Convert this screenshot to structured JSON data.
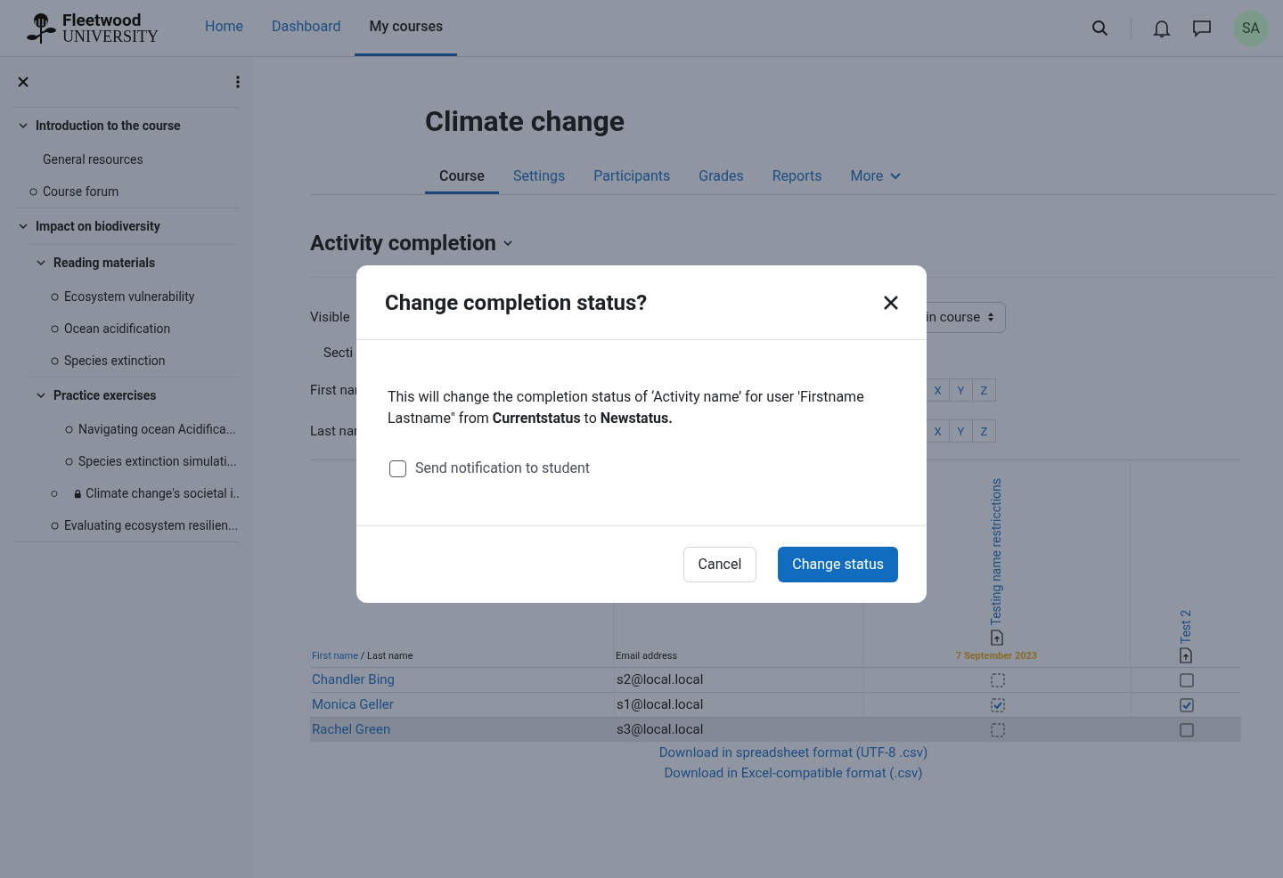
{
  "header": {
    "logo": {
      "name": "Fleetwood",
      "sub": "UNIVERSITY"
    },
    "nav": [
      {
        "label": "Home",
        "selected": false
      },
      {
        "label": "Dashboard",
        "selected": false
      },
      {
        "label": "My courses",
        "selected": true
      }
    ],
    "avatar": "SA"
  },
  "sidebar": {
    "items": [
      {
        "kind": "section",
        "label": "Introduction to the course",
        "expanded": true,
        "children": [
          {
            "kind": "page",
            "label": "General resources"
          },
          {
            "kind": "activity",
            "label": "Course forum"
          }
        ]
      },
      {
        "kind": "section",
        "label": "Impact on biodiversity",
        "expanded": true,
        "children": [
          {
            "kind": "section",
            "label": "Reading materials",
            "expanded": true,
            "children": [
              {
                "kind": "activity",
                "label": "Ecosystem vulnerability"
              },
              {
                "kind": "activity",
                "label": "Ocean acidification"
              },
              {
                "kind": "activity",
                "label": "Species extinction"
              }
            ]
          },
          {
            "kind": "section",
            "label": "Practice exercises",
            "expanded": true,
            "children": [
              {
                "kind": "activity",
                "label": "Navigating ocean Acidifica...",
                "indented": true
              },
              {
                "kind": "activity",
                "label": "Species extinction simulati...",
                "indented": true
              },
              {
                "kind": "activity",
                "label": "Climate change's societal i..",
                "locked": true
              },
              {
                "kind": "activity",
                "label": "Evaluating ecosystem resilien..."
              }
            ]
          }
        ]
      }
    ]
  },
  "course": {
    "title": "Climate change",
    "tabs": [
      {
        "label": "Course",
        "selected": true
      },
      {
        "label": "Settings",
        "selected": false
      },
      {
        "label": "Participants",
        "selected": false
      },
      {
        "label": "Grades",
        "selected": false
      },
      {
        "label": "Reports",
        "selected": false
      },
      {
        "label": "More",
        "selected": false
      }
    ],
    "heading": "Activity completion"
  },
  "filters": {
    "visible_label": "Visible",
    "select": "in course",
    "section_label": "Secti",
    "first_label": "First nar",
    "first_letters": [
      "X",
      "Y",
      "Z"
    ],
    "last_label": "Last nar",
    "last_letters": [
      "X",
      "Y",
      "Z"
    ]
  },
  "table": {
    "name_sort": "First name",
    "name_rest": "/ Last name",
    "email_header": "Email address",
    "activities": [
      {
        "name": "Testing name restricctions",
        "date": "7 September 2023",
        "kind": "auto"
      },
      {
        "name": "Test 2",
        "kind": "manual"
      }
    ],
    "rows": [
      {
        "name": "Chandler Bing",
        "email": "s2@local.local",
        "highlighted": false,
        "completions": [
          {
            "checked": false
          },
          {
            "checked": false
          }
        ]
      },
      {
        "name": "Monica Geller",
        "email": "s1@local.local",
        "highlighted": false,
        "completions": [
          {
            "checked": true
          },
          {
            "checked": true
          }
        ]
      },
      {
        "name": "Rachel Green",
        "email": "s3@local.local",
        "highlighted": true,
        "completions": [
          {
            "checked": false
          },
          {
            "checked": false
          }
        ]
      }
    ]
  },
  "downloads": [
    "Download in spreadsheet format (UTF-8 .csv)",
    "Download in Excel-compatible format (.csv)"
  ],
  "dialog": {
    "title": "Change completion status?",
    "body": "This will change the completion status of  ‘Activity name’ for user 'Firstname Lastname\" from **Currentstatus** to **Newstatus.**",
    "notify": {
      "label": "Send notification to student",
      "checked": false
    },
    "buttons": [
      {
        "label": "Cancel",
        "kind": "secondary"
      },
      {
        "label": "Change status",
        "kind": "primary"
      }
    ]
  }
}
